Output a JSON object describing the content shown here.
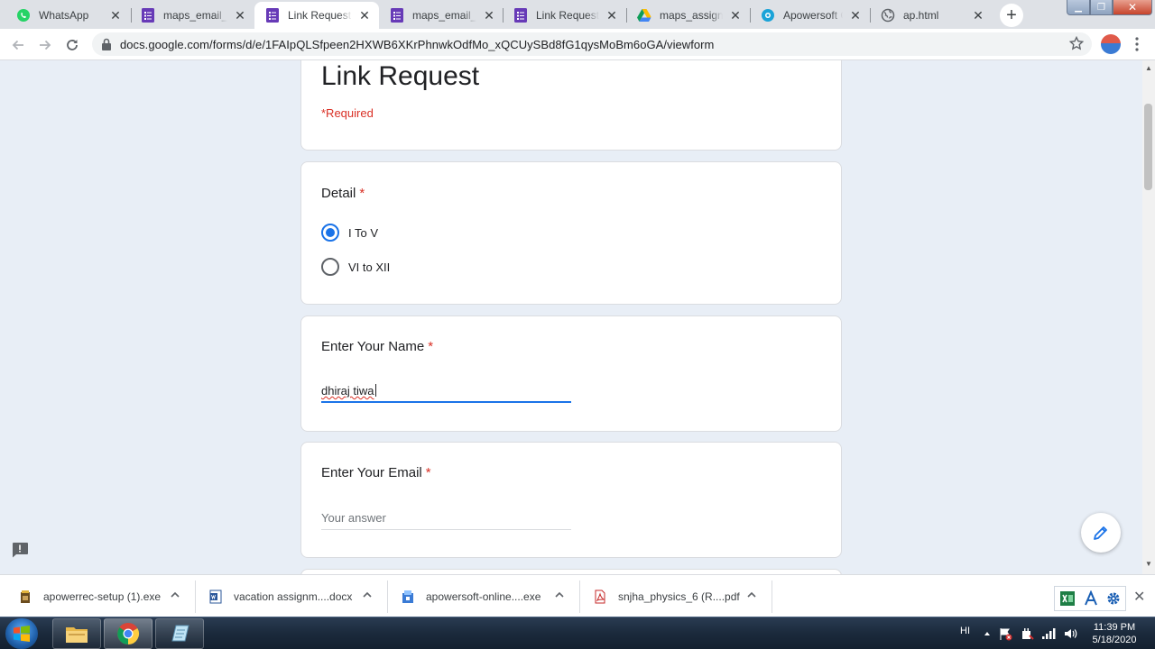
{
  "tabs": [
    {
      "title": "WhatsApp",
      "icon": "whatsapp-icon",
      "active": false
    },
    {
      "title": "maps_email_collection",
      "icon": "forms-icon",
      "active": false
    },
    {
      "title": "Link Request",
      "icon": "forms-icon",
      "active": true
    },
    {
      "title": "maps_email_collection",
      "icon": "forms-icon",
      "active": false
    },
    {
      "title": "Link Request",
      "icon": "forms-icon",
      "active": false
    },
    {
      "title": "maps_assignment",
      "icon": "drive-icon",
      "active": false
    },
    {
      "title": "Apowersoft Online",
      "icon": "apowersoft-icon",
      "active": false
    },
    {
      "title": "ap.html",
      "icon": "globe-icon",
      "active": false
    }
  ],
  "toolbar": {
    "url": "docs.google.com/forms/d/e/1FAIpQLSfpeen2HXWB6XKrPhnwkOdfMo_xQCUySBd8fG1qysMoBm6oGA/viewform"
  },
  "form": {
    "title": "Link Request",
    "required_note": "*Required",
    "questions": {
      "detail": {
        "label": "Detail",
        "required_mark": "*",
        "options": [
          {
            "label": "I To V",
            "selected": true
          },
          {
            "label": "VI to XII",
            "selected": false
          }
        ]
      },
      "name": {
        "label": "Enter Your Name",
        "required_mark": "*",
        "value": "dhiraj tiwa"
      },
      "email": {
        "label": "Enter Your Email",
        "required_mark": "*",
        "placeholder": "Your answer"
      }
    }
  },
  "downloads": [
    {
      "name": "apowerrec-setup (1).exe",
      "icon": "exe-icon"
    },
    {
      "name": "vacation assignm....docx",
      "icon": "word-doc-icon"
    },
    {
      "name": "apowersoft-online....exe",
      "icon": "installer-icon"
    },
    {
      "name": "snjha_physics_6 (R....pdf",
      "icon": "pdf-icon"
    }
  ],
  "taskbar": {
    "language": "HI",
    "time": "11:39 PM",
    "date": "5/18/2020"
  },
  "colors": {
    "accent": "#1a73e8",
    "required": "#d93025",
    "page_bg": "#e8eef6",
    "forms_purple": "#673ab7"
  }
}
